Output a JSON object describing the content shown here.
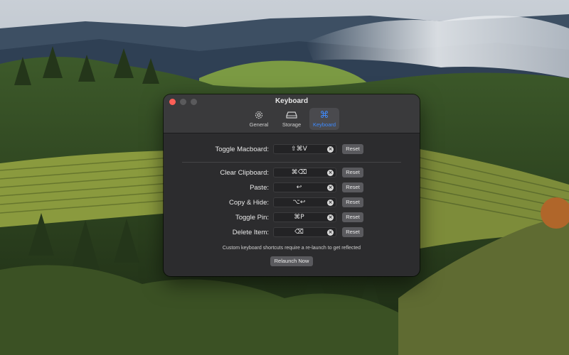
{
  "window": {
    "title": "Keyboard",
    "tabs": [
      {
        "label": "General",
        "icon": "gear-icon",
        "active": false
      },
      {
        "label": "Storage",
        "icon": "storage-drive-icon",
        "active": false
      },
      {
        "label": "Keyboard",
        "icon": "command-icon",
        "active": true
      }
    ]
  },
  "shortcuts": {
    "toggle": {
      "label": "Toggle Macboard:",
      "keys": "⇧⌘V",
      "reset": "Reset"
    },
    "clear": {
      "label": "Clear Clipboard:",
      "keys": "⌘⌫",
      "reset": "Reset"
    },
    "paste": {
      "label": "Paste:",
      "keys": "↩",
      "reset": "Reset"
    },
    "copyhide": {
      "label": "Copy & Hide:",
      "keys": "⌥↩",
      "reset": "Reset"
    },
    "pin": {
      "label": "Toggle Pin:",
      "keys": "⌘P",
      "reset": "Reset"
    },
    "delete": {
      "label": "Delete Item:",
      "keys": "⌫",
      "reset": "Reset"
    }
  },
  "note": "Custom keyboard shortcuts require a re-launch to get reflected",
  "relaunch_label": "Relaunch Now",
  "colors": {
    "accent": "#3e8bff",
    "window_bg": "#2c2c2e",
    "close": "#ff5f57"
  }
}
